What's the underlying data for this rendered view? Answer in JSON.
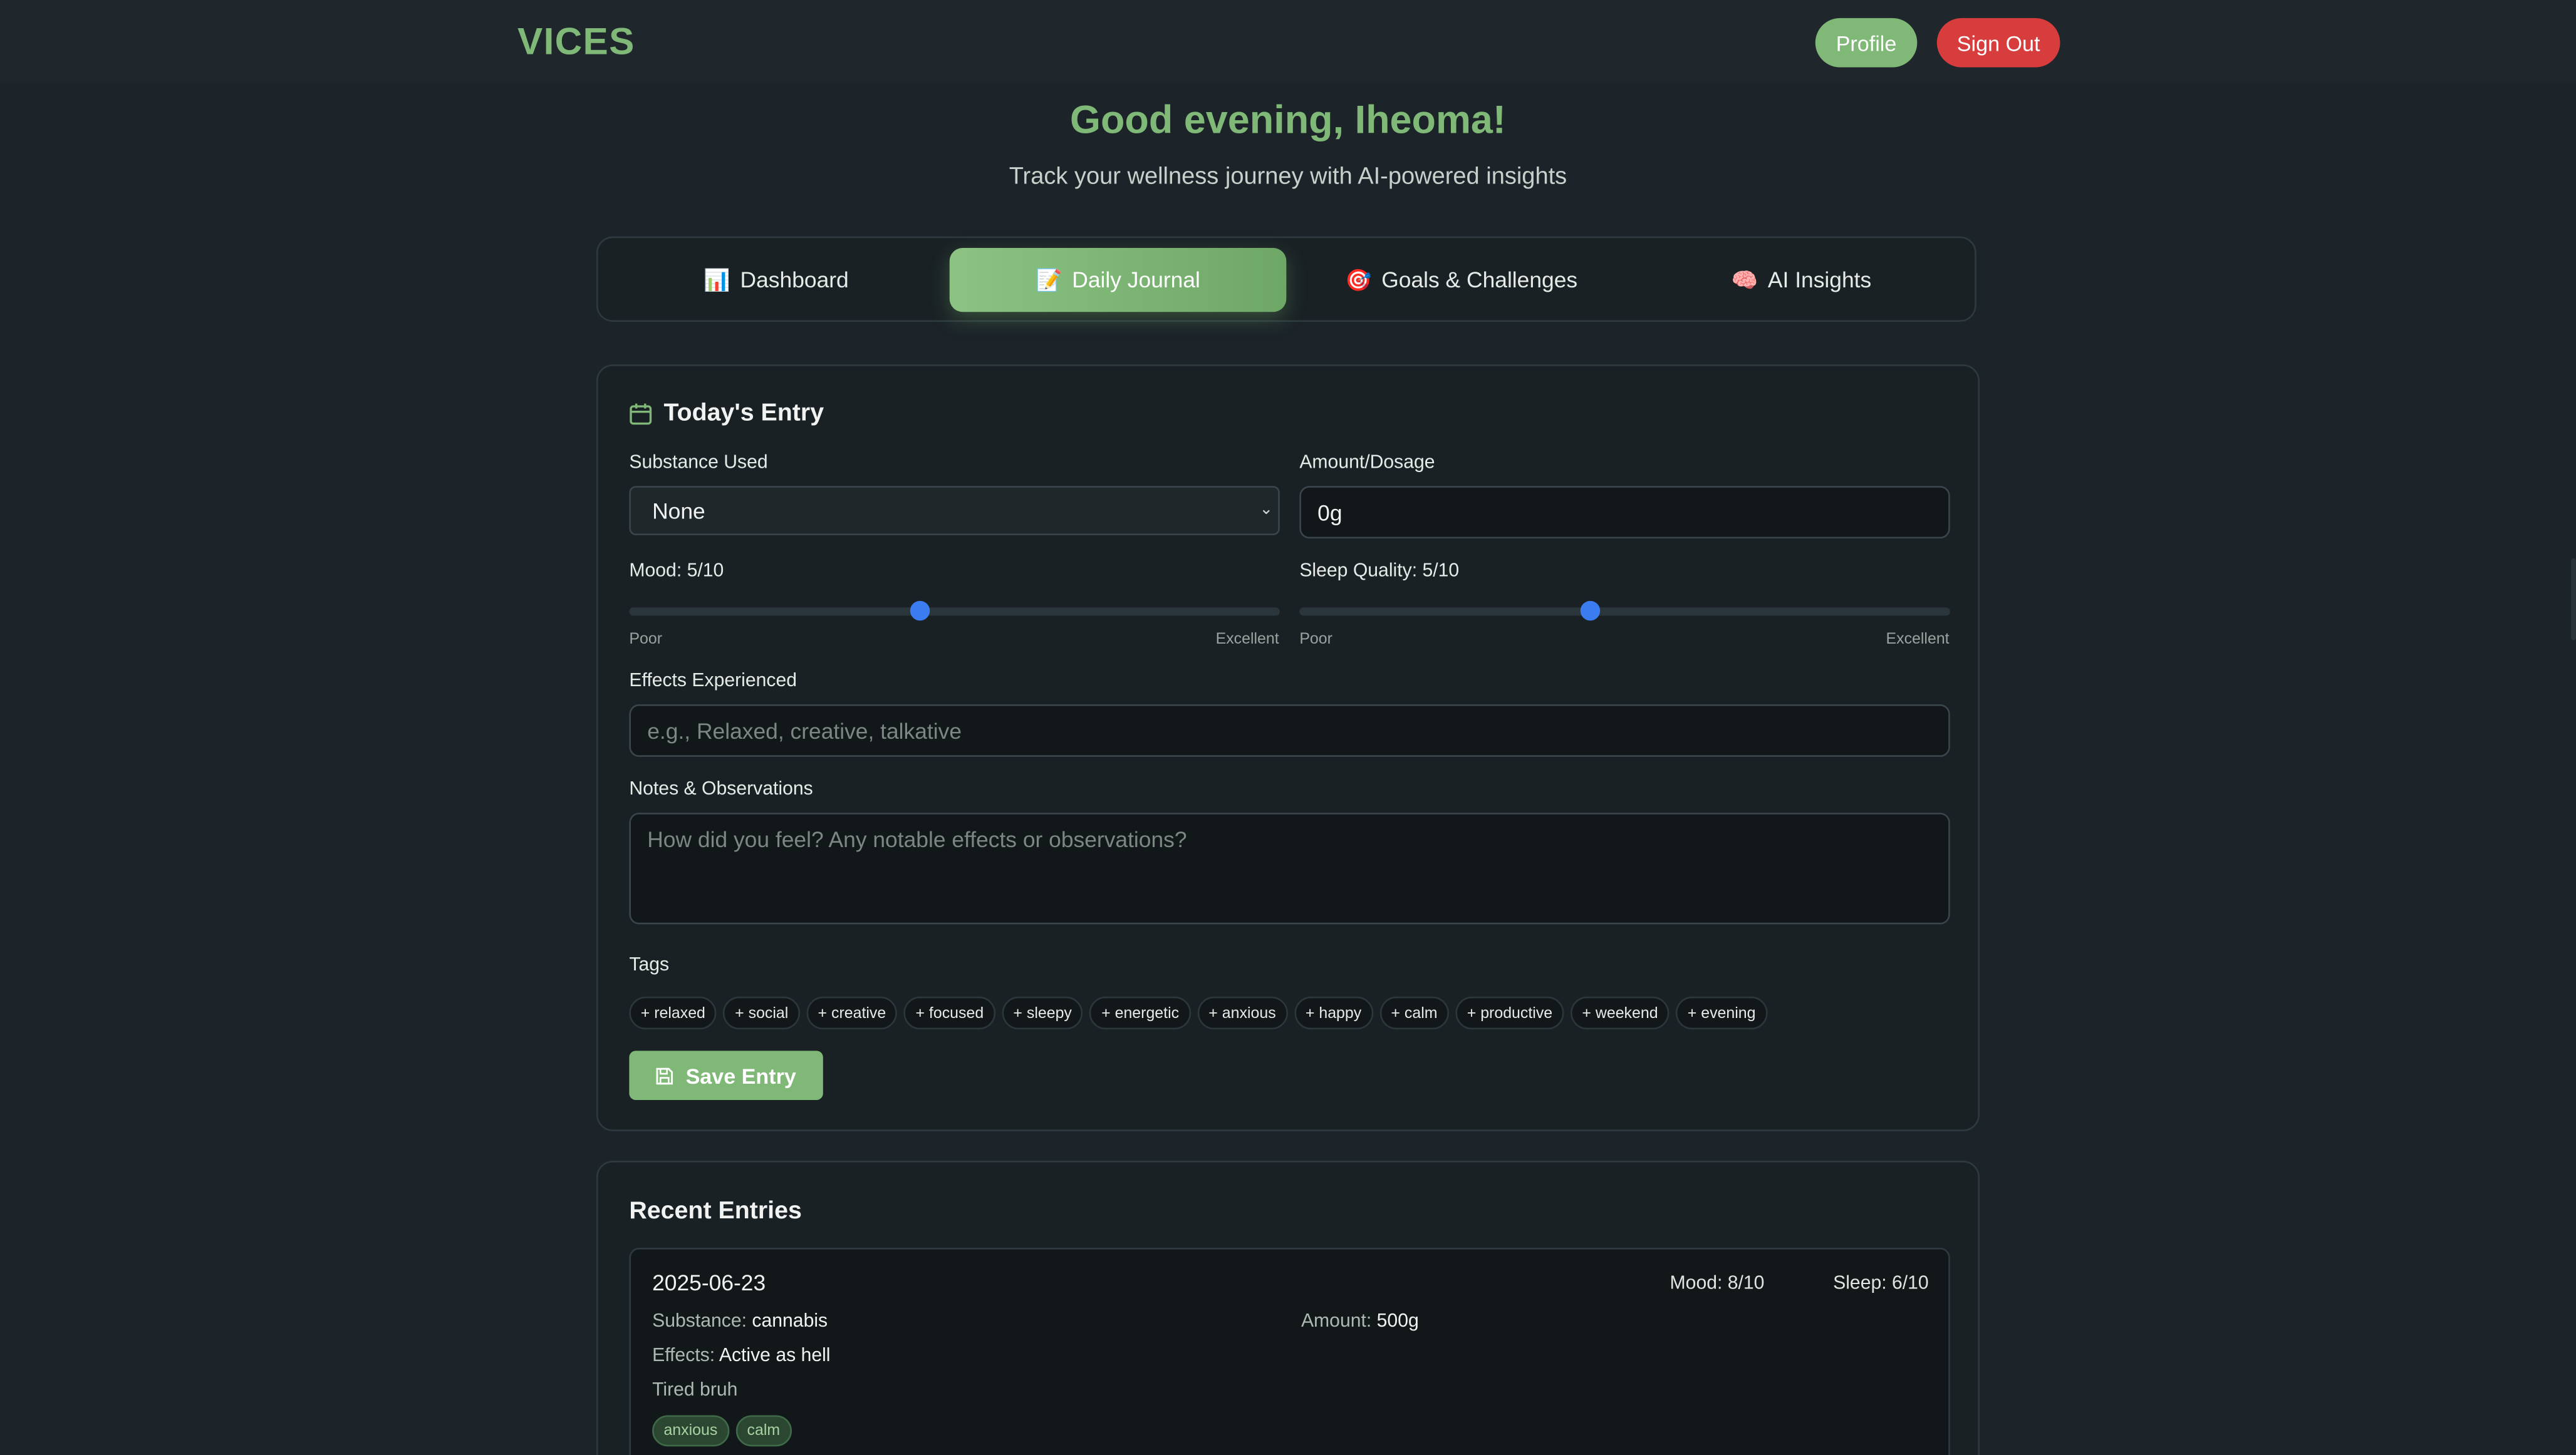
{
  "header": {
    "logo": "VICES",
    "profile_label": "Profile",
    "signout_label": "Sign Out"
  },
  "hero": {
    "greeting": "Good evening, Iheoma!",
    "subtitle": "Track your wellness journey with AI-powered insights"
  },
  "tabs": [
    {
      "icon": "📊",
      "label": "Dashboard",
      "active": false
    },
    {
      "icon": "📝",
      "label": "Daily Journal",
      "active": true
    },
    {
      "icon": "🎯",
      "label": "Goals & Challenges",
      "active": false
    },
    {
      "icon": "🧠",
      "label": "AI Insights",
      "active": false
    }
  ],
  "entry_form": {
    "title": "Today's Entry",
    "substance_label": "Substance Used",
    "substance_value": "None",
    "amount_label": "Amount/Dosage",
    "amount_value": "0g",
    "mood_label": "Mood: 5/10",
    "mood_value": 5,
    "sleep_label": "Sleep Quality: 5/10",
    "sleep_value": 5,
    "scale_min": "Poor",
    "scale_max": "Excellent",
    "effects_label": "Effects Experienced",
    "effects_placeholder": "e.g., Relaxed, creative, talkative",
    "notes_label": "Notes & Observations",
    "notes_placeholder": "How did you feel? Any notable effects or observations?",
    "tags_label": "Tags",
    "tags": [
      "+ relaxed",
      "+ social",
      "+ creative",
      "+ focused",
      "+ sleepy",
      "+ energetic",
      "+ anxious",
      "+ happy",
      "+ calm",
      "+ productive",
      "+ weekend",
      "+ evening"
    ],
    "save_label": "Save Entry"
  },
  "recent": {
    "title": "Recent Entries",
    "entries": [
      {
        "date": "2025-06-23",
        "mood": "Mood: 8/10",
        "sleep": "Sleep: 6/10",
        "substance_key": "Substance:",
        "substance": "cannabis",
        "amount_key": "Amount:",
        "amount": "500g",
        "effects_key": "Effects:",
        "effects": "Active as hell",
        "note": "Tired bruh",
        "tags": [
          "anxious",
          "calm"
        ]
      }
    ]
  },
  "colors": {
    "accent": "#7fb877",
    "danger": "#d83d3d",
    "slider": "#3b7df0",
    "background": "#1c2429"
  }
}
